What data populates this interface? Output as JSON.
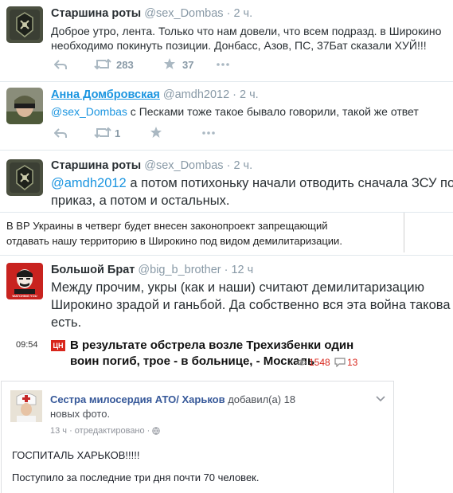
{
  "tweet1": {
    "name": "Старшина роты",
    "handle": "@sex_Dombas · 2 ч.",
    "text_line1": "Доброе утро, лента. Только что нам довели, что всем подразд. в Широкино",
    "text_line2": "необходимо покинуть позиции. Донбасс, Азов, ПС, 37Бат сказали ХУЙ!!!",
    "retweets": "283",
    "likes": "37"
  },
  "tweet2": {
    "name": "Анна Домбровская",
    "handle": "@amdh2012 · 2 ч.",
    "mention": "@sex_Dombas",
    "text": " с Песками тоже такое бывало говорили, такой же ответ",
    "retweets": "1"
  },
  "tweet3": {
    "name": "Старшина роты",
    "handle": "@sex_Dombas · 2 ч.",
    "mention": "@amdh2012",
    "text_line1": " а потом потихоньку начали отводить сначала ЗСУ под",
    "text_line2": "приказ, а потом и остальных."
  },
  "news_box": {
    "line1": "В ВР Украины в четверг будет внесен законопроект запрещающий",
    "line2": "отдавать нашу территорию в Широкино под видом демилитаризации."
  },
  "tweet4": {
    "name": "Большой Брат",
    "handle": "@big_b_brother · 12 ч",
    "avatar_caption": "WATCHING YOU",
    "text_line1": "Между прочим, укры (как и наши) считают демилитаризацию",
    "text_line2": "Широкино зрадой и ганьбой. Да собственно вся эта война такова и",
    "text_line3": "есть."
  },
  "news_item": {
    "time": "09:54",
    "badge": "ЦН",
    "title_line1": "В результате обстрела возле Трехизбенки один",
    "title_line2": "воин погиб, трое - в больнице, - Москаль",
    "views": "1548",
    "comments": "13"
  },
  "fb_post": {
    "name": "Сестра милосердия АТО/ Харьков",
    "action": " добавил(а) 18",
    "action_line2": "новых фото.",
    "meta": "13 ч · отредактировано · ",
    "text_line1": "ГОСПИТАЛЬ ХАРЬКОВ!!!!!",
    "text_line2": "Поступило за последние три дня почти 70 человек."
  },
  "colors": {
    "link_blue": "#1b95e0",
    "fb_blue": "#365899",
    "badge_red": "#d8261c",
    "action_grey": "#aab8c2"
  }
}
